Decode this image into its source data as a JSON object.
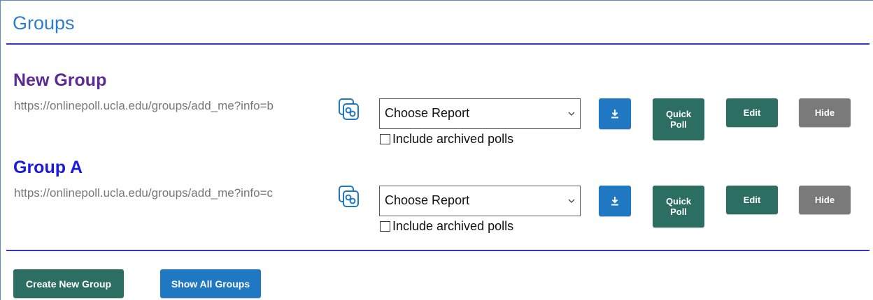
{
  "page": {
    "title": "Groups"
  },
  "colors": {
    "title_blue": "#2f7ec9",
    "rule_blue": "#3535c8",
    "group_purple": "#5c2a91",
    "group_blue": "#1a1ae0",
    "btn_blue": "#1f78c1",
    "btn_green": "#2c6f62",
    "btn_gray": "#7a7a7a"
  },
  "groups": [
    {
      "name": "New Group",
      "url": "https://onlinepoll.ucla.edu/groups/add_me?info=b",
      "copy_icon": "copy-link-icon",
      "report_select": "Choose Report",
      "archived_label": "Include archived polls",
      "archived_checked": false,
      "download_icon": "download-icon",
      "quick_poll_line1": "Quick",
      "quick_poll_line2": "Poll",
      "edit_label": "Edit",
      "hide_label": "Hide"
    },
    {
      "name": "Group A",
      "url": "https://onlinepoll.ucla.edu/groups/add_me?info=c",
      "copy_icon": "copy-link-icon",
      "report_select": "Choose Report",
      "archived_label": "Include archived polls",
      "archived_checked": false,
      "download_icon": "download-icon",
      "quick_poll_line1": "Quick",
      "quick_poll_line2": "Poll",
      "edit_label": "Edit",
      "hide_label": "Hide"
    }
  ],
  "footer": {
    "create_label": "Create New Group",
    "show_all_label": "Show All Groups"
  }
}
